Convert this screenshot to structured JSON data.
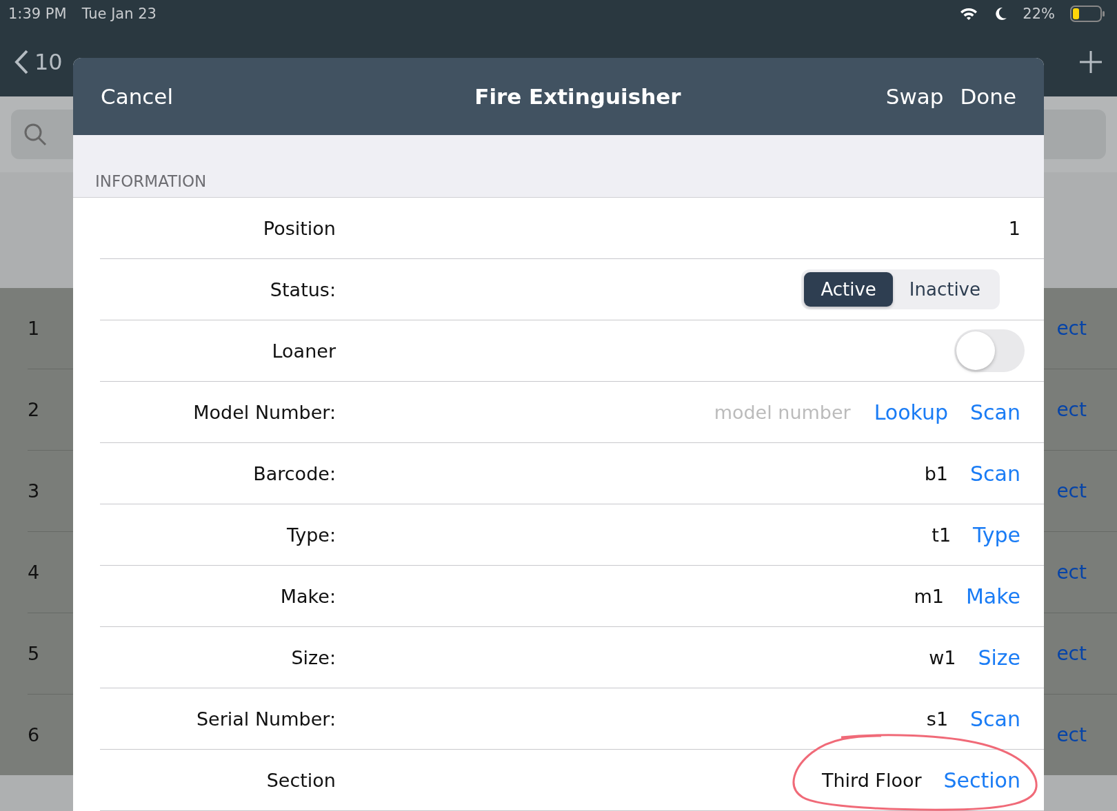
{
  "status_bar": {
    "time": "1:39 PM",
    "date": "Tue Jan 23",
    "battery": "22%"
  },
  "nav_bar": {
    "back_title": "10"
  },
  "background_rows": [
    {
      "number": "1",
      "link": "ect"
    },
    {
      "number": "2",
      "link": "ect"
    },
    {
      "number": "3",
      "link": "ect"
    },
    {
      "number": "4",
      "link": "ect"
    },
    {
      "number": "5",
      "link": "ect"
    },
    {
      "number": "6",
      "link": "ect"
    }
  ],
  "modal": {
    "cancel": "Cancel",
    "title": "Fire Extinguisher",
    "buttons": [
      "Swap",
      "Done"
    ],
    "section_header": "INFORMATION",
    "rows": [
      {
        "kind": "text",
        "label": "Position",
        "value": "1"
      },
      {
        "kind": "segmented",
        "label": "Status:",
        "options": [
          {
            "label": "Active",
            "selected": true
          },
          {
            "label": "Inactive",
            "selected": false
          }
        ]
      },
      {
        "kind": "toggle",
        "label": "Loaner",
        "on": false
      },
      {
        "kind": "field",
        "label": "Model Number:",
        "placeholder": "model number",
        "actions": [
          "Lookup",
          "Scan"
        ]
      },
      {
        "kind": "value",
        "label": "Barcode:",
        "value": "b1",
        "actions": [
          "Scan"
        ]
      },
      {
        "kind": "value",
        "label": "Type:",
        "value": "t1",
        "actions": [
          "Type"
        ]
      },
      {
        "kind": "value",
        "label": "Make:",
        "value": "m1",
        "actions": [
          "Make"
        ]
      },
      {
        "kind": "value",
        "label": "Size:",
        "value": "w1",
        "actions": [
          "Size"
        ]
      },
      {
        "kind": "value",
        "label": "Serial Number:",
        "value": "s1",
        "actions": [
          "Scan"
        ]
      },
      {
        "kind": "value",
        "label": "Section",
        "value": "Third Floor",
        "actions": [
          "Section"
        ],
        "circled": true
      }
    ]
  }
}
